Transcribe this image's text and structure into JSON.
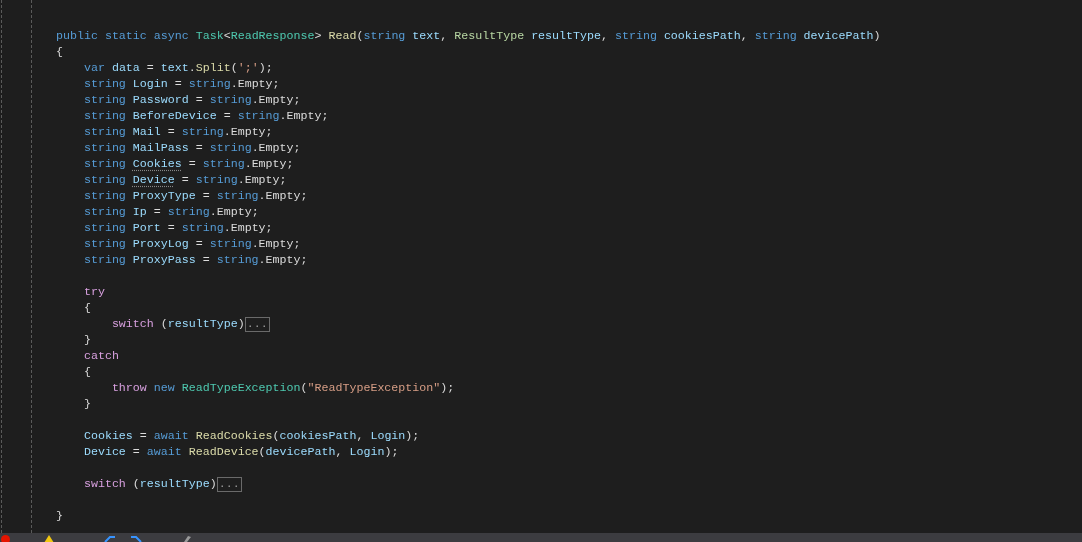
{
  "editor": {
    "blocks": [
      {
        "lines": [
          {
            "tokens": [
              {
                "kind": "keyword",
                "text": "public static async "
              },
              {
                "kind": "type",
                "text": "Task"
              },
              {
                "kind": "plain",
                "text": "<"
              },
              {
                "kind": "type",
                "text": "ReadResponse"
              },
              {
                "kind": "plain",
                "text": "> "
              },
              {
                "kind": "method",
                "text": "Read"
              },
              {
                "kind": "plain",
                "text": "("
              },
              {
                "kind": "keyword",
                "text": "string "
              },
              {
                "kind": "variable",
                "text": "text"
              },
              {
                "kind": "plain",
                "text": ", "
              },
              {
                "kind": "enum",
                "text": "ResultType "
              },
              {
                "kind": "variable",
                "text": "resultType"
              },
              {
                "kind": "plain",
                "text": ", "
              },
              {
                "kind": "keyword",
                "text": "string "
              },
              {
                "kind": "variable",
                "text": "cookiesPath"
              },
              {
                "kind": "plain",
                "text": ", "
              },
              {
                "kind": "keyword",
                "text": "string "
              },
              {
                "kind": "variable",
                "text": "devicePath"
              },
              {
                "kind": "plain",
                "text": ")"
              }
            ]
          },
          {
            "tokens": [
              {
                "kind": "plain",
                "text": "{"
              }
            ]
          },
          {
            "tokens": [
              {
                "kind": "keyword",
                "text": "    var "
              },
              {
                "kind": "variable",
                "text": "data"
              },
              {
                "kind": "plain",
                "text": " = "
              },
              {
                "kind": "variable",
                "text": "text"
              },
              {
                "kind": "plain",
                "text": "."
              },
              {
                "kind": "method",
                "text": "Split"
              },
              {
                "kind": "plain",
                "text": "("
              },
              {
                "kind": "string",
                "text": "';'"
              },
              {
                "kind": "plain",
                "text": ");"
              }
            ]
          },
          {
            "tokens": [
              {
                "kind": "keyword",
                "text": "    string "
              },
              {
                "kind": "variable",
                "text": "Login"
              },
              {
                "kind": "plain",
                "text": " = "
              },
              {
                "kind": "keyword",
                "text": "string"
              },
              {
                "kind": "plain",
                "text": ".Empty;"
              }
            ]
          },
          {
            "tokens": [
              {
                "kind": "keyword",
                "text": "    string "
              },
              {
                "kind": "variable",
                "text": "Password"
              },
              {
                "kind": "plain",
                "text": " = "
              },
              {
                "kind": "keyword",
                "text": "string"
              },
              {
                "kind": "plain",
                "text": ".Empty;"
              }
            ]
          },
          {
            "tokens": [
              {
                "kind": "keyword",
                "text": "    string "
              },
              {
                "kind": "variable",
                "text": "BeforeDevice"
              },
              {
                "kind": "plain",
                "text": " = "
              },
              {
                "kind": "keyword",
                "text": "string"
              },
              {
                "kind": "plain",
                "text": ".Empty;"
              }
            ]
          },
          {
            "tokens": [
              {
                "kind": "keyword",
                "text": "    string "
              },
              {
                "kind": "variable",
                "text": "Mail"
              },
              {
                "kind": "plain",
                "text": " = "
              },
              {
                "kind": "keyword",
                "text": "string"
              },
              {
                "kind": "plain",
                "text": ".Empty;"
              }
            ]
          },
          {
            "tokens": [
              {
                "kind": "keyword",
                "text": "    string "
              },
              {
                "kind": "variable",
                "text": "MailPass"
              },
              {
                "kind": "plain",
                "text": " = "
              },
              {
                "kind": "keyword",
                "text": "string"
              },
              {
                "kind": "plain",
                "text": ".Empty;"
              }
            ]
          },
          {
            "tokens": [
              {
                "kind": "keyword",
                "text": "    string "
              },
              {
                "kind": "hinted",
                "text": "Cookies"
              },
              {
                "kind": "plain",
                "text": " = "
              },
              {
                "kind": "keyword",
                "text": "string"
              },
              {
                "kind": "plain",
                "text": ".Empty;"
              }
            ]
          },
          {
            "tokens": [
              {
                "kind": "keyword",
                "text": "    string "
              },
              {
                "kind": "hinted",
                "text": "Device"
              },
              {
                "kind": "plain",
                "text": " = "
              },
              {
                "kind": "keyword",
                "text": "string"
              },
              {
                "kind": "plain",
                "text": ".Empty;"
              }
            ]
          },
          {
            "tokens": [
              {
                "kind": "keyword",
                "text": "    string "
              },
              {
                "kind": "variable",
                "text": "ProxyType"
              },
              {
                "kind": "plain",
                "text": " = "
              },
              {
                "kind": "keyword",
                "text": "string"
              },
              {
                "kind": "plain",
                "text": ".Empty;"
              }
            ]
          },
          {
            "tokens": [
              {
                "kind": "keyword",
                "text": "    string "
              },
              {
                "kind": "variable",
                "text": "Ip"
              },
              {
                "kind": "plain",
                "text": " = "
              },
              {
                "kind": "keyword",
                "text": "string"
              },
              {
                "kind": "plain",
                "text": ".Empty;"
              }
            ]
          },
          {
            "tokens": [
              {
                "kind": "keyword",
                "text": "    string "
              },
              {
                "kind": "variable",
                "text": "Port"
              },
              {
                "kind": "plain",
                "text": " = "
              },
              {
                "kind": "keyword",
                "text": "string"
              },
              {
                "kind": "plain",
                "text": ".Empty;"
              }
            ]
          },
          {
            "tokens": [
              {
                "kind": "keyword",
                "text": "    string "
              },
              {
                "kind": "variable",
                "text": "ProxyLog"
              },
              {
                "kind": "plain",
                "text": " = "
              },
              {
                "kind": "keyword",
                "text": "string"
              },
              {
                "kind": "plain",
                "text": ".Empty;"
              }
            ]
          },
          {
            "tokens": [
              {
                "kind": "keyword",
                "text": "    string "
              },
              {
                "kind": "variable",
                "text": "ProxyPass"
              },
              {
                "kind": "plain",
                "text": " = "
              },
              {
                "kind": "keyword",
                "text": "string"
              },
              {
                "kind": "plain",
                "text": ".Empty;"
              }
            ]
          }
        ]
      },
      {
        "lines": [
          {
            "tokens": [
              {
                "kind": "control",
                "text": "    try"
              }
            ]
          },
          {
            "tokens": [
              {
                "kind": "plain",
                "text": "    {"
              }
            ]
          },
          {
            "tokens": [
              {
                "kind": "control",
                "text": "        switch"
              },
              {
                "kind": "plain",
                "text": " ("
              },
              {
                "kind": "variable",
                "text": "resultType"
              },
              {
                "kind": "plain",
                "text": ")"
              }
            ],
            "collapsed": "..."
          },
          {
            "tokens": [
              {
                "kind": "plain",
                "text": "    }"
              }
            ]
          },
          {
            "tokens": [
              {
                "kind": "control",
                "text": "    catch"
              }
            ]
          },
          {
            "tokens": [
              {
                "kind": "plain",
                "text": "    {"
              }
            ]
          },
          {
            "tokens": [
              {
                "kind": "control",
                "text": "        throw "
              },
              {
                "kind": "keyword",
                "text": "new "
              },
              {
                "kind": "type",
                "text": "ReadTypeException"
              },
              {
                "kind": "plain",
                "text": "("
              },
              {
                "kind": "string",
                "text": "\"ReadTypeException\""
              },
              {
                "kind": "plain",
                "text": ");"
              }
            ]
          },
          {
            "tokens": [
              {
                "kind": "plain",
                "text": "    }"
              }
            ]
          }
        ]
      },
      {
        "lines": [
          {
            "tokens": [
              {
                "kind": "variable",
                "text": "    Cookies"
              },
              {
                "kind": "plain",
                "text": " = "
              },
              {
                "kind": "keyword",
                "text": "await "
              },
              {
                "kind": "method",
                "text": "ReadCookies"
              },
              {
                "kind": "plain",
                "text": "("
              },
              {
                "kind": "variable",
                "text": "cookiesPath"
              },
              {
                "kind": "plain",
                "text": ", "
              },
              {
                "kind": "variable",
                "text": "Login"
              },
              {
                "kind": "plain",
                "text": ");"
              }
            ]
          },
          {
            "tokens": [
              {
                "kind": "variable",
                "text": "    Device"
              },
              {
                "kind": "plain",
                "text": " = "
              },
              {
                "kind": "keyword",
                "text": "await "
              },
              {
                "kind": "method",
                "text": "ReadDevice"
              },
              {
                "kind": "plain",
                "text": "("
              },
              {
                "kind": "variable",
                "text": "devicePath"
              },
              {
                "kind": "plain",
                "text": ", "
              },
              {
                "kind": "variable",
                "text": "Login"
              },
              {
                "kind": "plain",
                "text": ");"
              }
            ]
          }
        ]
      },
      {
        "lines": [
          {
            "tokens": [
              {
                "kind": "control",
                "text": "    switch"
              },
              {
                "kind": "plain",
                "text": " ("
              },
              {
                "kind": "variable",
                "text": "resultType"
              },
              {
                "kind": "plain",
                "text": ")"
              }
            ],
            "collapsed": "..."
          }
        ]
      },
      {
        "lines": [
          {
            "tokens": [
              {
                "kind": "plain",
                "text": "}"
              }
            ]
          }
        ]
      }
    ]
  }
}
